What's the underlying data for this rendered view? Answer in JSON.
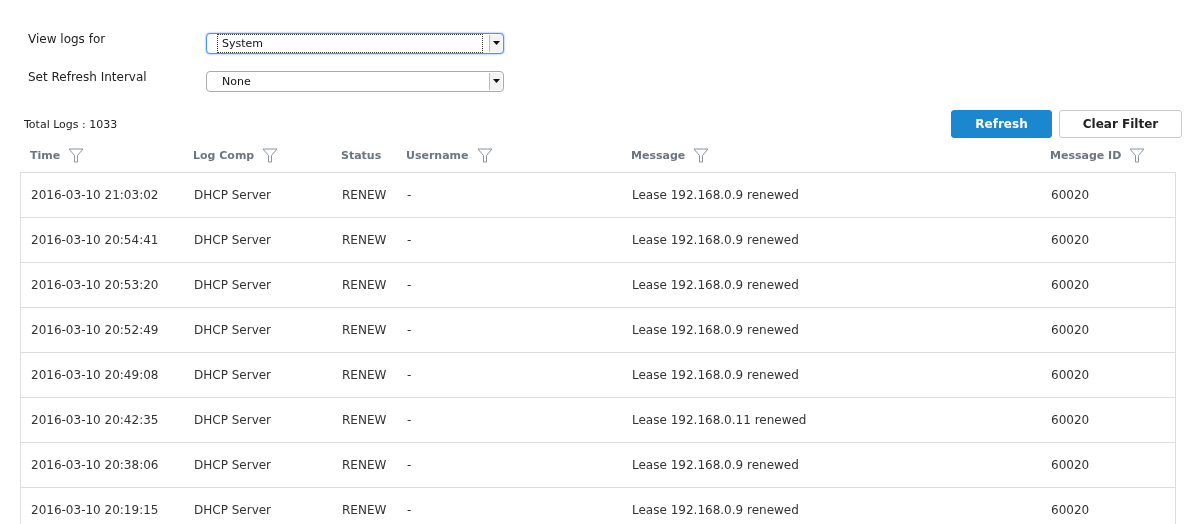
{
  "filters": [
    {
      "label": "View logs for",
      "value": "System",
      "focused": true
    },
    {
      "label": "Set Refresh Interval",
      "value": "None",
      "focused": false
    }
  ],
  "total_logs": "Total Logs : 1033",
  "buttons": [
    {
      "label": "Refresh",
      "kind": "primary"
    },
    {
      "label": "Clear Filter",
      "kind": "secondary"
    }
  ],
  "table": {
    "columns": [
      {
        "label": "Time",
        "filterable": true
      },
      {
        "label": "Log Comp",
        "filterable": true
      },
      {
        "label": "Status",
        "filterable": false
      },
      {
        "label": "Username",
        "filterable": true
      },
      {
        "label": "Message",
        "filterable": true
      },
      {
        "label": "Message ID",
        "filterable": true
      }
    ],
    "rows": [
      [
        "2016-03-10 21:03:02",
        "DHCP Server",
        "RENEW",
        "-",
        "Lease 192.168.0.9 renewed",
        "60020"
      ],
      [
        "2016-03-10 20:54:41",
        "DHCP Server",
        "RENEW",
        "-",
        "Lease 192.168.0.9 renewed",
        "60020"
      ],
      [
        "2016-03-10 20:53:20",
        "DHCP Server",
        "RENEW",
        "-",
        "Lease 192.168.0.9 renewed",
        "60020"
      ],
      [
        "2016-03-10 20:52:49",
        "DHCP Server",
        "RENEW",
        "-",
        "Lease 192.168.0.9 renewed",
        "60020"
      ],
      [
        "2016-03-10 20:49:08",
        "DHCP Server",
        "RENEW",
        "-",
        "Lease 192.168.0.9 renewed",
        "60020"
      ],
      [
        "2016-03-10 20:42:35",
        "DHCP Server",
        "RENEW",
        "-",
        "Lease 192.168.0.11 renewed",
        "60020"
      ],
      [
        "2016-03-10 20:38:06",
        "DHCP Server",
        "RENEW",
        "-",
        "Lease 192.168.0.9 renewed",
        "60020"
      ],
      [
        "2016-03-10 20:19:15",
        "DHCP Server",
        "RENEW",
        "-",
        "Lease 192.168.0.9 renewed",
        "60020"
      ]
    ]
  }
}
